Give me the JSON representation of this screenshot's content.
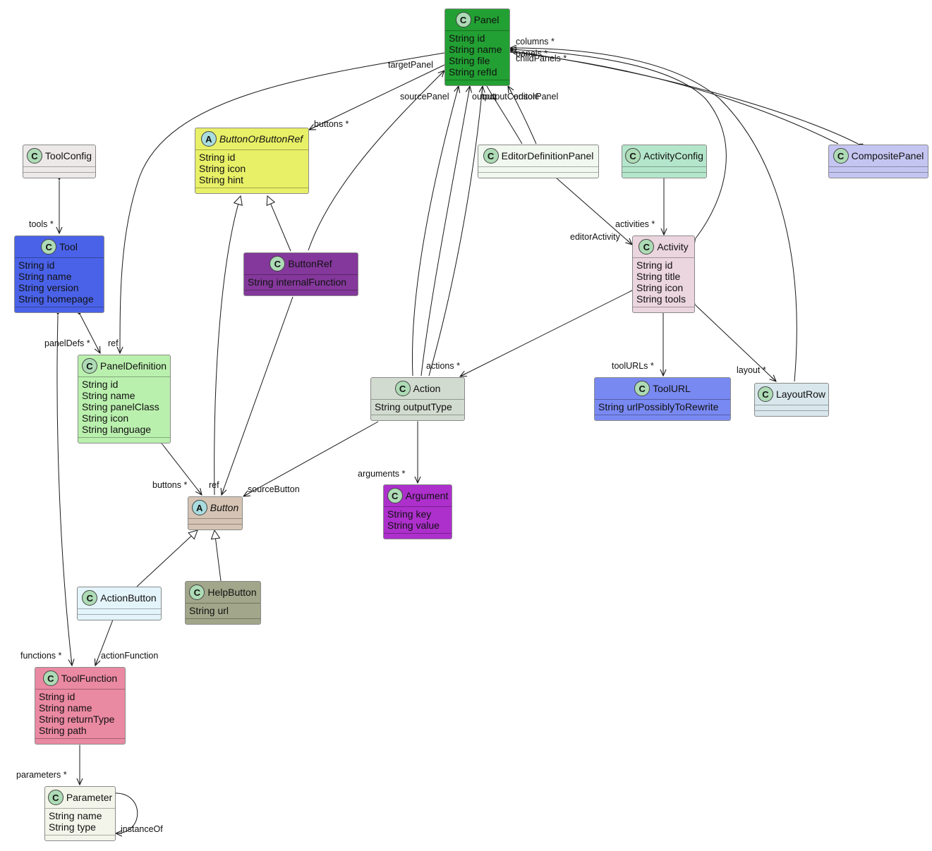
{
  "diagram": {
    "type": "uml-class-diagram",
    "classes": [
      {
        "id": "Panel",
        "name": "Panel",
        "kind": "class",
        "color": "#22a033",
        "attributes": [
          "String id",
          "String name",
          "String file",
          "String refId"
        ]
      },
      {
        "id": "ToolConfig",
        "name": "ToolConfig",
        "kind": "class",
        "color": "#ece9e8",
        "attributes": []
      },
      {
        "id": "ButtonOrButtonRef",
        "name": "ButtonOrButtonRef",
        "kind": "abstract",
        "color": "#e8f067",
        "attributes": [
          "String id",
          "String icon",
          "String hint"
        ]
      },
      {
        "id": "EditorDefinitionPanel",
        "name": "EditorDefinitionPanel",
        "kind": "class",
        "color": "#f1f8ef",
        "attributes": []
      },
      {
        "id": "ActivityConfig",
        "name": "ActivityConfig",
        "kind": "class",
        "color": "#b4e6cb",
        "attributes": []
      },
      {
        "id": "CompositePanel",
        "name": "CompositePanel",
        "kind": "class",
        "color": "#c5c5f2",
        "attributes": []
      },
      {
        "id": "Tool",
        "name": "Tool",
        "kind": "class",
        "color": "#4a62e7",
        "attributes": [
          "String id",
          "String name",
          "String version",
          "String homepage"
        ]
      },
      {
        "id": "ButtonRef",
        "name": "ButtonRef",
        "kind": "class",
        "color": "#84389b",
        "attributes": [
          "String internalFunction"
        ]
      },
      {
        "id": "Activity",
        "name": "Activity",
        "kind": "class",
        "color": "#ebd5de",
        "attributes": [
          "String id",
          "String title",
          "String icon",
          "String tools"
        ]
      },
      {
        "id": "PanelDefinition",
        "name": "PanelDefinition",
        "kind": "class",
        "color": "#baf0ae",
        "attributes": [
          "String id",
          "String name",
          "String panelClass",
          "String icon",
          "String language"
        ]
      },
      {
        "id": "Action",
        "name": "Action",
        "kind": "class",
        "color": "#d2dbcf",
        "attributes": [
          "String outputType"
        ]
      },
      {
        "id": "ToolURL",
        "name": "ToolURL",
        "kind": "class",
        "color": "#7989f2",
        "attributes": [
          "String urlPossiblyToRewrite"
        ]
      },
      {
        "id": "LayoutRow",
        "name": "LayoutRow",
        "kind": "class",
        "color": "#d8e7ec",
        "attributes": []
      },
      {
        "id": "Button",
        "name": "Button",
        "kind": "abstract",
        "color": "#d5c4b4",
        "attributes": []
      },
      {
        "id": "Argument",
        "name": "Argument",
        "kind": "class",
        "color": "#ad2fcc",
        "attributes": [
          "String key",
          "String value"
        ]
      },
      {
        "id": "ActionButton",
        "name": "ActionButton",
        "kind": "class",
        "color": "#e4f4fb",
        "attributes": []
      },
      {
        "id": "HelpButton",
        "name": "HelpButton",
        "kind": "class",
        "color": "#a2a68a",
        "attributes": [
          "String url"
        ]
      },
      {
        "id": "ToolFunction",
        "name": "ToolFunction",
        "kind": "class",
        "color": "#ea89a2",
        "attributes": [
          "String id",
          "String name",
          "String returnType",
          "String path"
        ]
      },
      {
        "id": "Parameter",
        "name": "Parameter",
        "kind": "class",
        "color": "#f4f5ea",
        "attributes": [
          "String name",
          "String type"
        ]
      }
    ],
    "relations": [
      {
        "from": "ToolConfig",
        "to": "Tool",
        "type": "composition",
        "label": "tools *"
      },
      {
        "from": "Tool",
        "to": "PanelDefinition",
        "type": "composition",
        "label": "panelDefs *"
      },
      {
        "from": "Tool",
        "to": "ToolFunction",
        "type": "composition",
        "label": "functions *"
      },
      {
        "from": "Panel",
        "to": "PanelDefinition",
        "type": "association",
        "label": "ref"
      },
      {
        "from": "Panel",
        "to": "ButtonOrButtonRef",
        "type": "composition",
        "label": "buttons *"
      },
      {
        "from": "ButtonRef",
        "to": "Panel",
        "type": "association",
        "label": "targetPanel"
      },
      {
        "from": "ButtonRef",
        "to": "ButtonOrButtonRef",
        "type": "inheritance",
        "label": ""
      },
      {
        "from": "Button",
        "to": "ButtonOrButtonRef",
        "type": "inheritance",
        "label": ""
      },
      {
        "from": "ButtonRef",
        "to": "Button",
        "type": "association",
        "label": "ref"
      },
      {
        "from": "PanelDefinition",
        "to": "Button",
        "type": "composition",
        "label": "buttons *"
      },
      {
        "from": "Action",
        "to": "Button",
        "type": "association",
        "label": "sourceButton"
      },
      {
        "from": "Action",
        "to": "Panel",
        "type": "association",
        "label": "sourcePanel"
      },
      {
        "from": "Action",
        "to": "Panel",
        "type": "association",
        "label": "output"
      },
      {
        "from": "Action",
        "to": "Panel",
        "type": "association",
        "label": "outputConsole"
      },
      {
        "from": "EditorDefinitionPanel",
        "to": "Panel",
        "type": "association",
        "label": "editorPanel"
      },
      {
        "from": "EditorDefinitionPanel",
        "to": "Activity",
        "type": "association",
        "label": "editorActivity"
      },
      {
        "from": "ActivityConfig",
        "to": "Activity",
        "type": "composition",
        "label": "activities *"
      },
      {
        "from": "Activity",
        "to": "Panel",
        "type": "composition",
        "label": "panels *"
      },
      {
        "from": "Activity",
        "to": "Action",
        "type": "composition",
        "label": "actions *"
      },
      {
        "from": "Activity",
        "to": "ToolURL",
        "type": "composition",
        "label": "toolURLs *"
      },
      {
        "from": "Activity",
        "to": "LayoutRow",
        "type": "composition",
        "label": "layout *"
      },
      {
        "from": "LayoutRow",
        "to": "Panel",
        "type": "association",
        "label": "columns *"
      },
      {
        "from": "CompositePanel",
        "to": "Panel",
        "type": "composition",
        "label": "childPanels *"
      },
      {
        "from": "Action",
        "to": "Argument",
        "type": "composition",
        "label": "arguments *"
      },
      {
        "from": "ActionButton",
        "to": "Button",
        "type": "inheritance",
        "label": ""
      },
      {
        "from": "HelpButton",
        "to": "Button",
        "type": "inheritance",
        "label": ""
      },
      {
        "from": "ActionButton",
        "to": "ToolFunction",
        "type": "association",
        "label": "actionFunction"
      },
      {
        "from": "ToolFunction",
        "to": "Parameter",
        "type": "composition",
        "label": "parameters *"
      },
      {
        "from": "Parameter",
        "to": "Parameter",
        "type": "association",
        "label": "instanceOf"
      }
    ]
  }
}
